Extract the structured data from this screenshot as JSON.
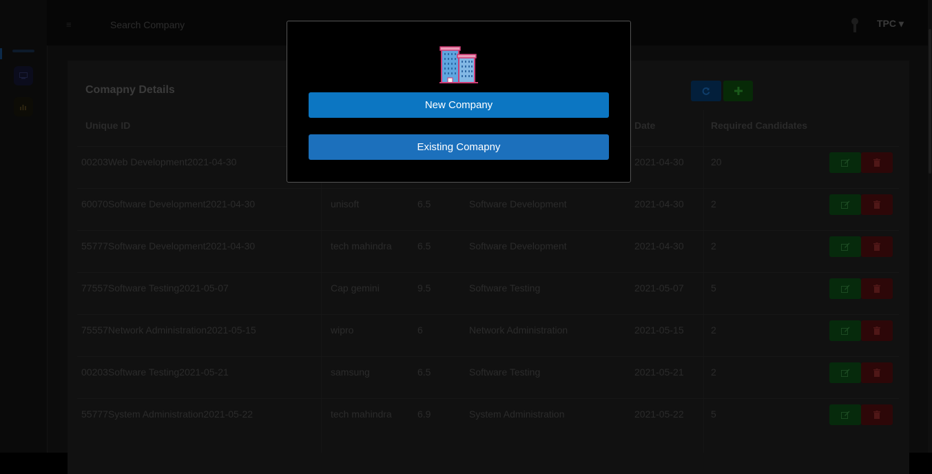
{
  "topbar": {
    "search_placeholder": "Search Company",
    "user_label": "TPC ▾"
  },
  "card": {
    "title": "Comapny Details",
    "columns": [
      "Unique ID",
      "Date",
      "Required Candidates"
    ]
  },
  "rows": [
    {
      "id": "00203Web Development2021-04-30",
      "company": "",
      "cgpa": "",
      "domain": "",
      "date": "2021-04-30",
      "required": "20"
    },
    {
      "id": "60070Software Development2021-04-30",
      "company": "unisoft",
      "cgpa": "6.5",
      "domain": "Software Development",
      "date": "2021-04-30",
      "required": "2"
    },
    {
      "id": "55777Software Development2021-04-30",
      "company": "tech mahindra",
      "cgpa": "6.5",
      "domain": "Software Development",
      "date": "2021-04-30",
      "required": "2"
    },
    {
      "id": "77557Software Testing2021-05-07",
      "company": "Cap gemini",
      "cgpa": "9.5",
      "domain": "Software Testing",
      "date": "2021-05-07",
      "required": "5"
    },
    {
      "id": "75557Network Administration2021-05-15",
      "company": "wipro",
      "cgpa": "6",
      "domain": "Network Administration",
      "date": "2021-05-15",
      "required": "2"
    },
    {
      "id": "00203Software Testing2021-05-21",
      "company": "samsung",
      "cgpa": "6.5",
      "domain": "Software Testing",
      "date": "2021-05-21",
      "required": "2"
    },
    {
      "id": "55777System Administration2021-05-22",
      "company": "tech mahindra",
      "cgpa": "6.9",
      "domain": "System Administration",
      "date": "2021-05-22",
      "required": "5"
    }
  ],
  "modal": {
    "icon": "office-building-icon",
    "new_label": "New Company",
    "existing_label": "Existing Comapny"
  },
  "icons": {
    "menu": "hamburger-icon",
    "user": "user-icon",
    "refresh": "refresh-icon",
    "add": "plus-icon",
    "edit": "edit-icon",
    "delete": "trash-icon"
  },
  "colors": {
    "primary": "#0c76c2",
    "modal_bg": "#000000",
    "success_dim": "#062a0c",
    "danger_dim": "#2d0708"
  }
}
